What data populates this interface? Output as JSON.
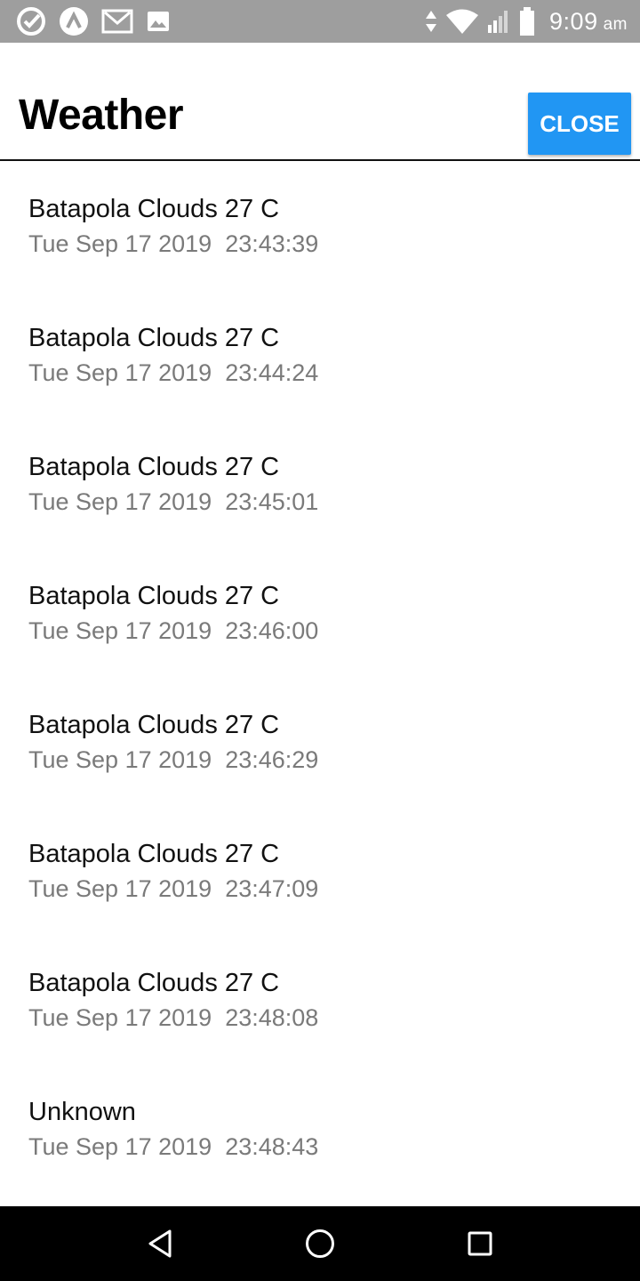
{
  "status_bar": {
    "icons_left": [
      "check-circle-icon",
      "app-a-icon",
      "gmail-icon",
      "image-icon"
    ],
    "icons_right": [
      "data-arrows-icon",
      "wifi-icon",
      "signal-icon",
      "battery-icon"
    ],
    "time": "9:09",
    "ampm": "am"
  },
  "header": {
    "title": "Weather",
    "close_label": "CLOSE",
    "accent_color": "#2196f3"
  },
  "entries": [
    {
      "title": "Batapola Clouds 27 C",
      "date": "Tue Sep 17 2019",
      "time": "23:43:39"
    },
    {
      "title": "Batapola Clouds 27 C",
      "date": "Tue Sep 17 2019",
      "time": "23:44:24"
    },
    {
      "title": "Batapola Clouds 27 C",
      "date": "Tue Sep 17 2019",
      "time": "23:45:01"
    },
    {
      "title": "Batapola Clouds 27 C",
      "date": "Tue Sep 17 2019",
      "time": "23:46:00"
    },
    {
      "title": "Batapola Clouds 27 C",
      "date": "Tue Sep 17 2019",
      "time": "23:46:29"
    },
    {
      "title": "Batapola Clouds 27 C",
      "date": "Tue Sep 17 2019",
      "time": "23:47:09"
    },
    {
      "title": "Batapola Clouds 27 C",
      "date": "Tue Sep 17 2019",
      "time": "23:48:08"
    },
    {
      "title": "Unknown",
      "date": "Tue Sep 17 2019",
      "time": "23:48:43"
    }
  ],
  "nav_bar": {
    "buttons": [
      "back-icon",
      "home-icon",
      "recents-icon"
    ]
  }
}
